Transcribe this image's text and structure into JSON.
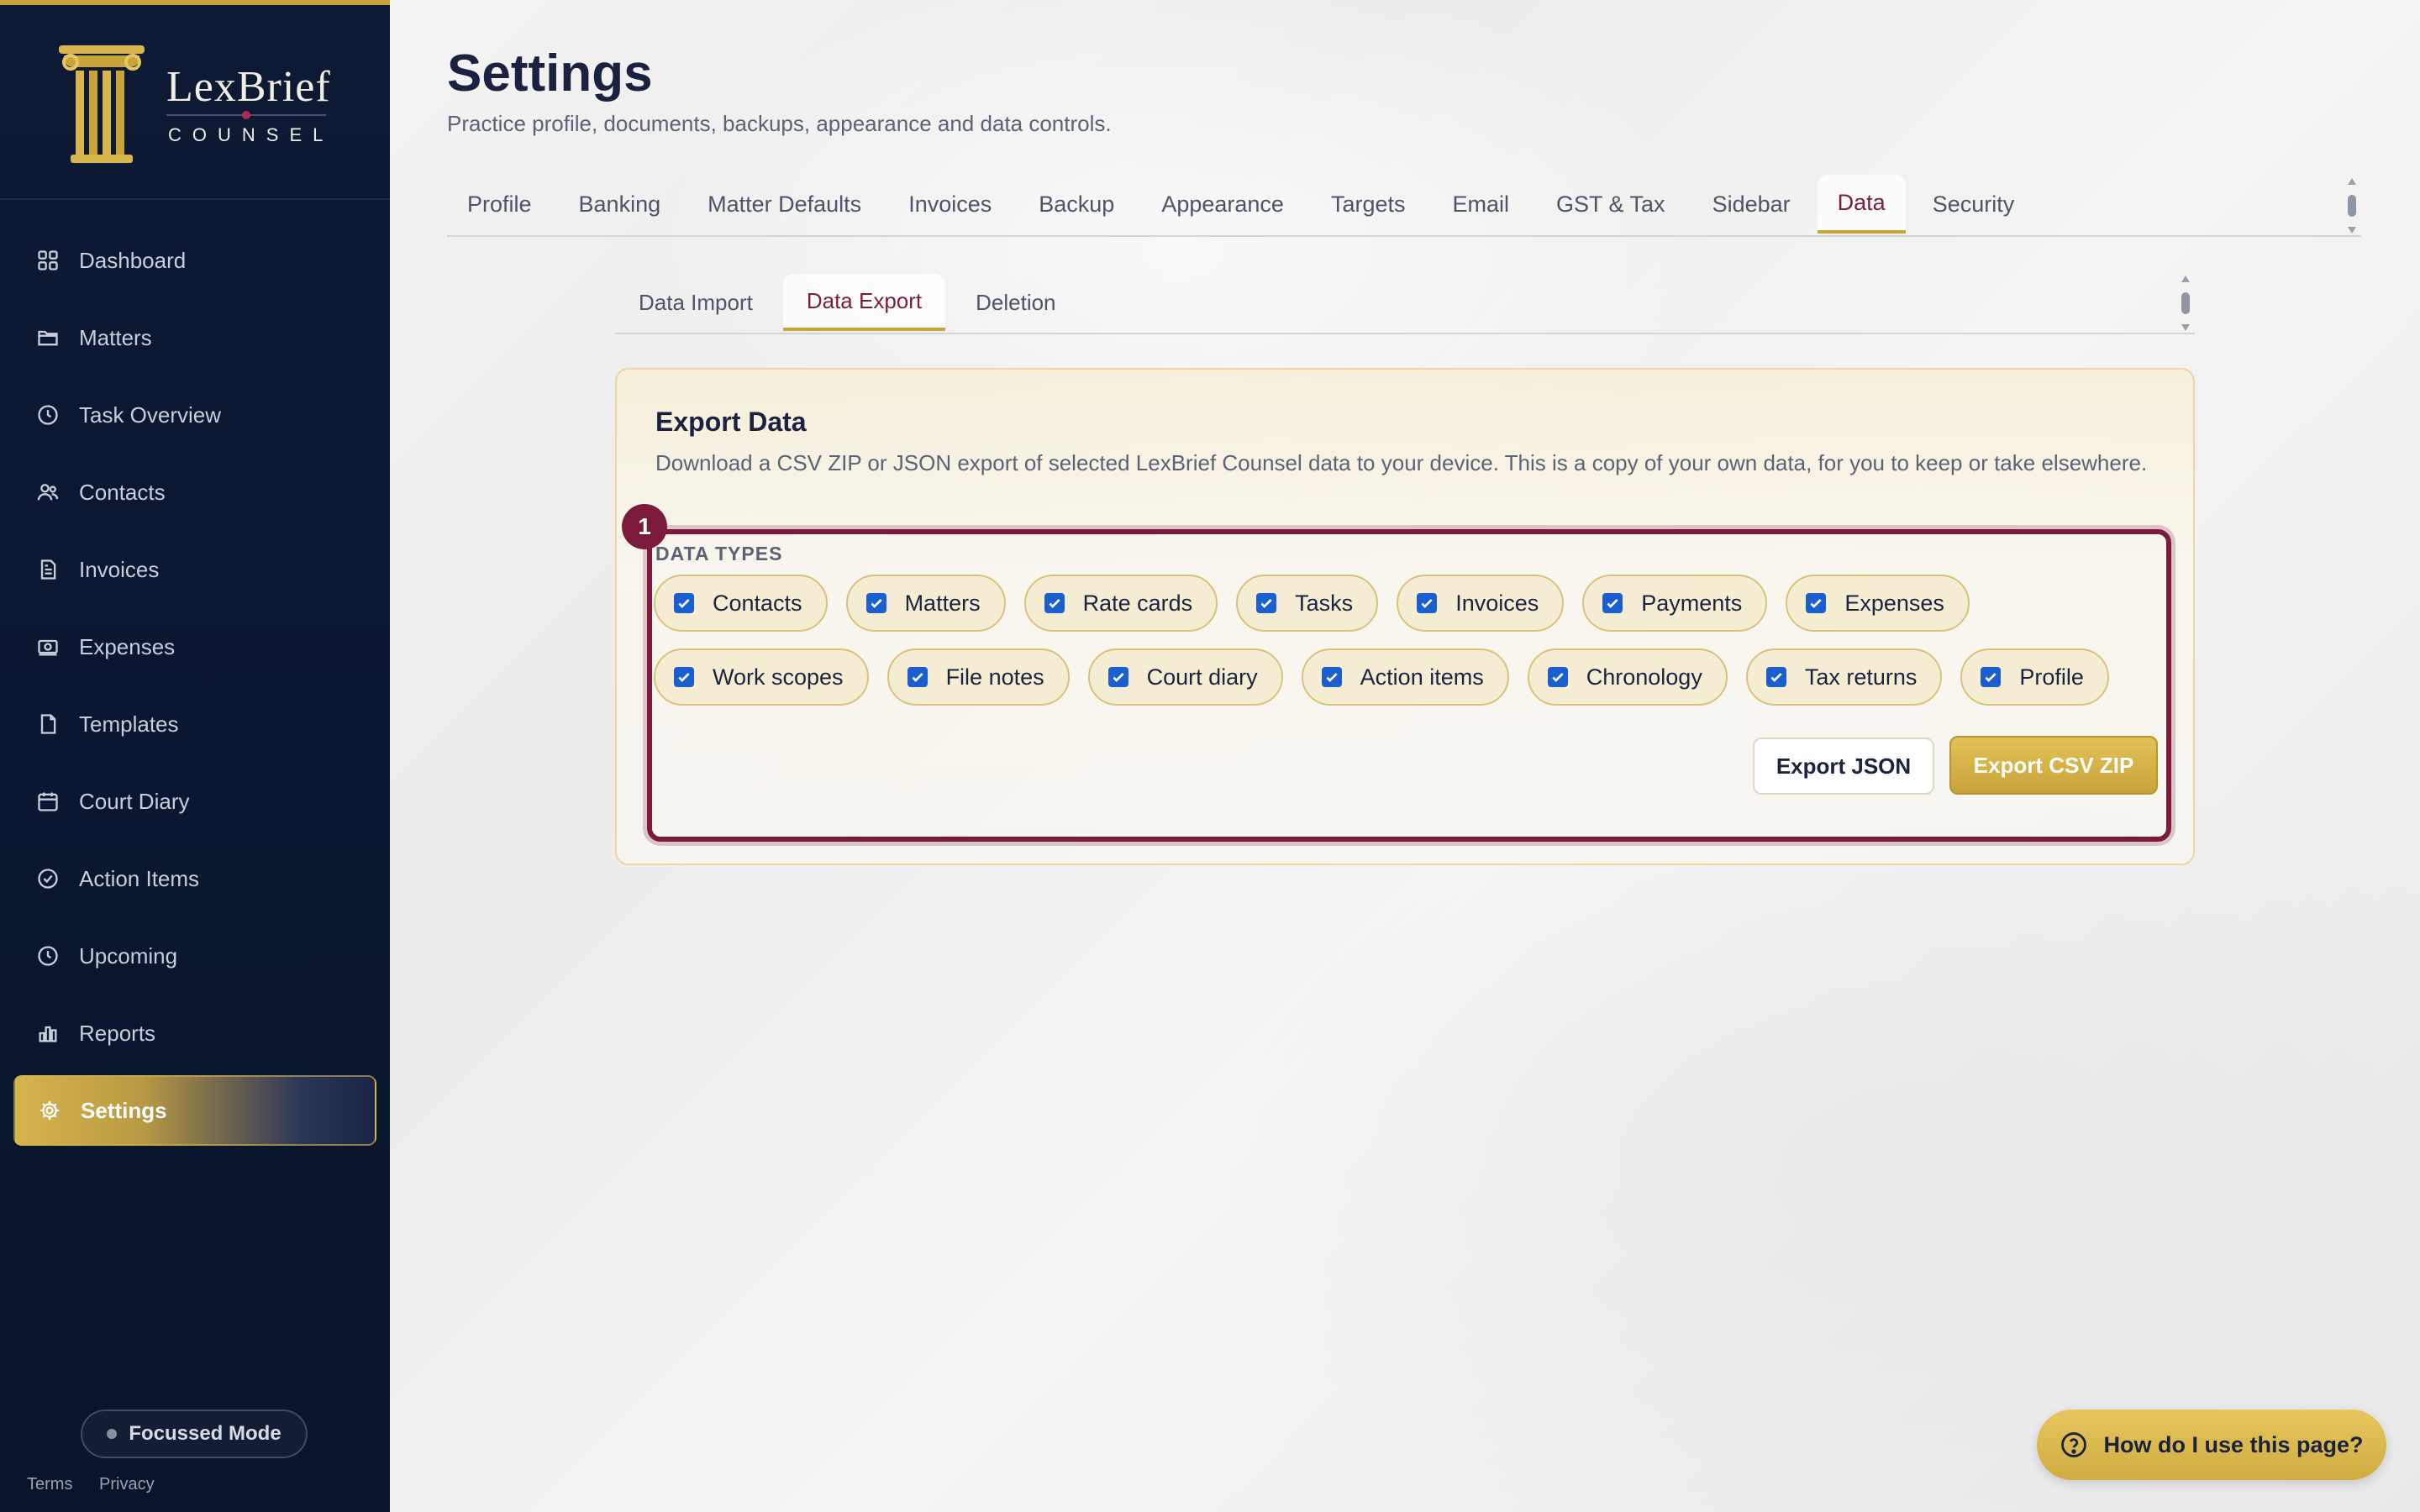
{
  "brand": {
    "name": "LexBrief",
    "subtitle": "COUNSEL"
  },
  "sidebar": {
    "items": [
      {
        "label": "Dashboard",
        "icon": "dashboard-icon"
      },
      {
        "label": "Matters",
        "icon": "folder-icon"
      },
      {
        "label": "Task Overview",
        "icon": "clock-icon"
      },
      {
        "label": "Contacts",
        "icon": "users-icon"
      },
      {
        "label": "Invoices",
        "icon": "invoice-icon"
      },
      {
        "label": "Expenses",
        "icon": "expense-icon"
      },
      {
        "label": "Templates",
        "icon": "document-icon"
      },
      {
        "label": "Court Diary",
        "icon": "calendar-icon"
      },
      {
        "label": "Action Items",
        "icon": "check-circle-icon"
      },
      {
        "label": "Upcoming",
        "icon": "clock-icon"
      },
      {
        "label": "Reports",
        "icon": "bar-chart-icon"
      },
      {
        "label": "Settings",
        "icon": "gear-icon",
        "active": true
      }
    ],
    "focus_mode_label": "Focussed Mode",
    "footer_terms": "Terms",
    "footer_privacy": "Privacy"
  },
  "header": {
    "title": "Settings",
    "subtitle": "Practice profile, documents, backups, appearance and data controls."
  },
  "tabs": [
    "Profile",
    "Banking",
    "Matter Defaults",
    "Invoices",
    "Backup",
    "Appearance",
    "Targets",
    "Email",
    "GST & Tax",
    "Sidebar",
    "Data",
    "Security"
  ],
  "active_tab": "Data",
  "subtabs": [
    "Data Import",
    "Data Export",
    "Deletion"
  ],
  "active_subtab": "Data Export",
  "export": {
    "title": "Export Data",
    "description": "Download a CSV ZIP or JSON export of selected LexBrief Counsel data to your device. This is a copy of your own data, for you to keep or take elsewhere.",
    "badge": "1",
    "data_types_label": "DATA TYPES",
    "row1": [
      "Contacts",
      "Matters",
      "Rate cards",
      "Tasks",
      "Invoices",
      "Payments",
      "Expenses"
    ],
    "row2": [
      "Work scopes",
      "File notes",
      "Court diary",
      "Action items",
      "Chronology",
      "Tax returns",
      "Profile"
    ],
    "json_label": "Export JSON",
    "csv_label": "Export CSV ZIP"
  },
  "help": {
    "label": "How do I use this page?"
  },
  "colors": {
    "navy": "#0e1a35",
    "gold": "#c9a43a",
    "maroon": "#7b1a3c",
    "checkbox": "#1a5fd0"
  }
}
